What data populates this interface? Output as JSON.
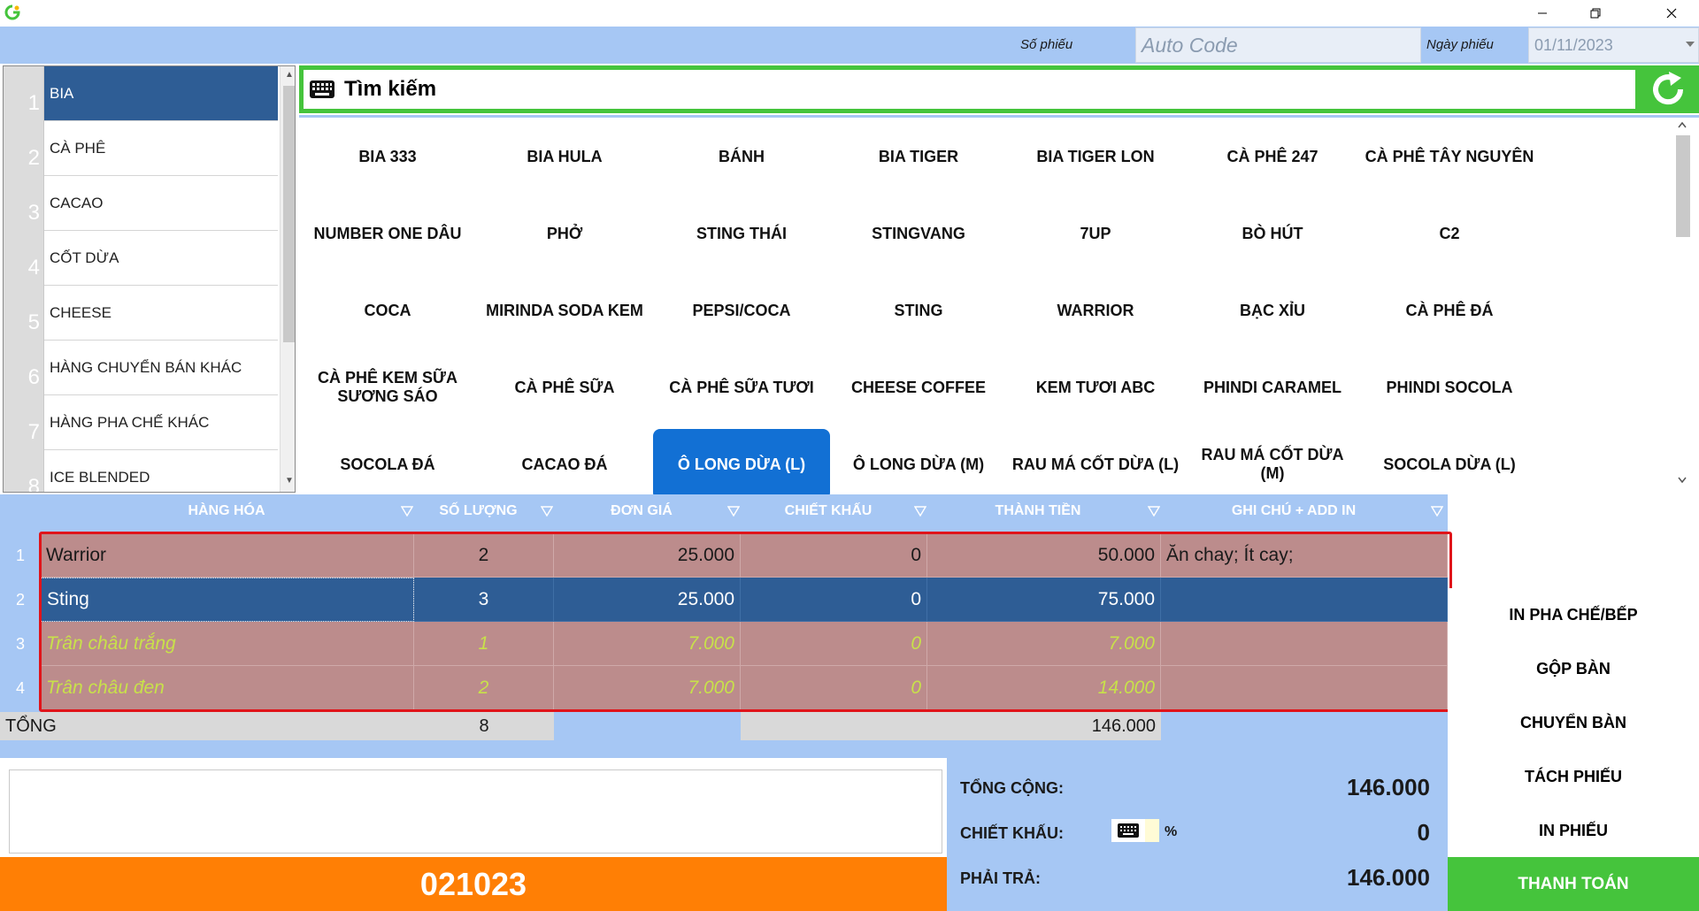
{
  "header": {
    "so_phieu_label": "Số phiếu",
    "so_phieu_value": "Auto Code",
    "ngay_phieu_label": "Ngày phiếu",
    "ngay_phieu_value": "01/11/2023"
  },
  "categories": [
    {
      "num": "1",
      "label": "BIA",
      "selected": true
    },
    {
      "num": "2",
      "label": "CÀ PHÊ"
    },
    {
      "num": "3",
      "label": "CACAO"
    },
    {
      "num": "4",
      "label": "CỐT DỪA"
    },
    {
      "num": "5",
      "label": "CHEESE"
    },
    {
      "num": "6",
      "label": "HÀNG CHUYỂN BÁN KHÁC"
    },
    {
      "num": "7",
      "label": "HÀNG PHA CHẾ KHÁC"
    },
    {
      "num": "8",
      "label": "ICE BLENDED"
    }
  ],
  "search": {
    "label": "Tìm kiếm"
  },
  "products": [
    [
      "BIA 333",
      "BIA HULA",
      "BÁNH",
      "BIA TIGER",
      "BIA TIGER LON",
      "CÀ PHÊ 247",
      "CÀ PHÊ TÂY NGUYÊN"
    ],
    [
      "NUMBER ONE DÂU",
      "PHỞ",
      "STING THÁI",
      "STINGVANG",
      "7UP",
      "BÒ HÚT",
      "C2"
    ],
    [
      "COCA",
      "MIRINDA SODA KEM",
      "PEPSI/COCA",
      "STING",
      "WARRIOR",
      "BẠC XỈU",
      "CÀ PHÊ ĐÁ"
    ],
    [
      "CÀ PHÊ KEM SỮA SƯƠNG SÁO",
      "CÀ PHÊ SỮA",
      "CÀ PHÊ SỮA TƯƠI",
      "CHEESE COFFEE",
      "KEM TƯƠI ABC",
      "PHINDI CARAMEL",
      "PHINDI SOCOLA"
    ],
    [
      "SOCOLA ĐÁ",
      "CACAO ĐÁ",
      "Ô LONG DỪA (L)",
      "Ô LONG DỪA (M)",
      "RAU MÁ CỐT DỪA (L)",
      "RAU MÁ CỐT DỪA (M)",
      "SOCOLA DỪA (L)"
    ]
  ],
  "selected_product": "Ô LONG DỪA (L)",
  "table": {
    "headers": {
      "hang_hoa": "HÀNG HÓA",
      "so_luong": "SỐ LƯỢNG",
      "don_gia": "ĐƠN GIÁ",
      "chiet_khau": "CHIẾT KHẤU",
      "thanh_tien": "THÀNH TIỀN",
      "ghi_chu": "GHI CHÚ + ADD IN"
    },
    "rows": [
      {
        "num": "1",
        "name": "Warrior",
        "qty": "2",
        "price": "25.000",
        "discount": "0",
        "total": "50.000",
        "note": "Ăn chay; Ít cay;"
      },
      {
        "num": "2",
        "name": "Sting",
        "qty": "3",
        "price": "25.000",
        "discount": "0",
        "total": "75.000",
        "note": ""
      },
      {
        "num": "3",
        "name": "Trân châu trắng",
        "qty": "1",
        "price": "7.000",
        "discount": "0",
        "total": "7.000",
        "note": ""
      },
      {
        "num": "4",
        "name": "Trân châu đen",
        "qty": "2",
        "price": "7.000",
        "discount": "0",
        "total": "14.000",
        "note": ""
      }
    ],
    "total_label": "TỔNG",
    "total_qty": "8",
    "total_amount": "146.000"
  },
  "actions": {
    "in_pha_che": "IN PHA CHẾ/BẾP",
    "gop_ban": "GỘP BÀN",
    "chuyen_ban": "CHUYỂN BÀN",
    "tach_phieu": "TÁCH PHIẾU",
    "in_phieu": "IN PHIẾU",
    "thanh_toan": "THANH TOÁN"
  },
  "summary": {
    "tong_cong_label": "TỔNG CỘNG:",
    "tong_cong_value": "146.000",
    "chiet_khau_label": "CHIẾT KHẤU:",
    "chiet_khau_pct": "%",
    "chiet_khau_value": "0",
    "phai_tra_label": "PHẢI TRẢ:",
    "phai_tra_value": "146.000"
  },
  "code": "021023",
  "colors": {
    "header_blue": "#a6c7f4",
    "selected_blue": "#2e5d95",
    "product_selected": "#1270d4",
    "green": "#45c43c",
    "orange": "#ff7f05",
    "row_bg": "#bc8c8c",
    "addon_text": "#c8e14a",
    "highlight_red": "#e0141a"
  }
}
